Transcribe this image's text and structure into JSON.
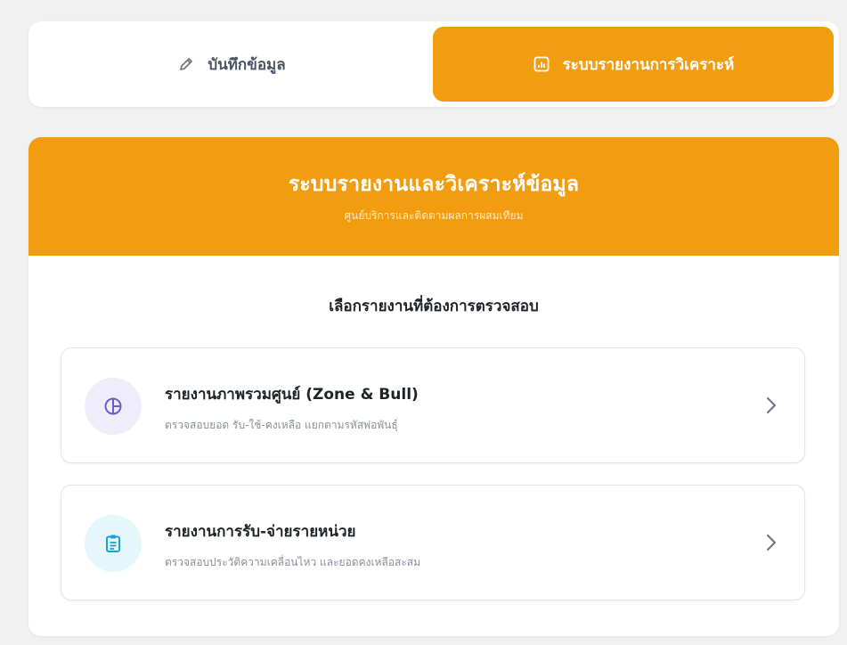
{
  "tabs": {
    "record": {
      "label": "บันทึกข้อมูล",
      "icon": "pencil-icon"
    },
    "report": {
      "label": "ระบบรายงานการวิเคราะห์",
      "icon": "chart-icon",
      "active": true
    }
  },
  "header": {
    "title": "ระบบรายงานและวิเคราะห์ข้อมูล",
    "subtitle": "ศูนย์บริการและติดตามผลการผสมเทียม"
  },
  "section_title": "เลือกรายงานที่ต้องการตรวจสอบ",
  "reports": [
    {
      "title": "รายงานภาพรวมศูนย์ (Zone & Bull)",
      "description": "ตรวจสอบยอด รับ-ใช้-คงเหลือ แยกตามรหัสพ่อพันธุ์",
      "icon": "pie-chart-icon"
    },
    {
      "title": "รายงานการรับ-จ่ายรายหน่วย",
      "description": "ตรวจสอบประวัติความเคลื่อนไหว และยอดคงเหลือสะสม",
      "icon": "clipboard-icon"
    }
  ],
  "colors": {
    "accent": "#f29d0f",
    "purple_icon": "#6d5bd0",
    "blue_icon": "#1aa3d6"
  }
}
